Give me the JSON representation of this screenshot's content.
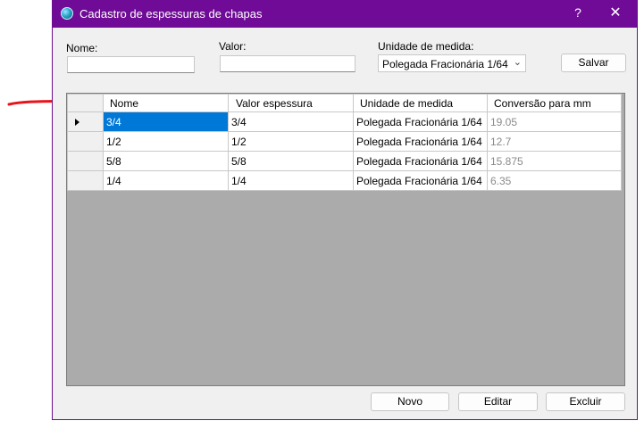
{
  "window": {
    "title": "Cadastro de espessuras de chapas"
  },
  "titlebar": {
    "help": "?",
    "close": "✕"
  },
  "form": {
    "nome_label": "Nome:",
    "nome_value": "",
    "valor_label": "Valor:",
    "valor_value": "",
    "unidade_label": "Unidade de medida:",
    "unidade_selected": "Polegada Fracionária 1/64",
    "salvar": "Salvar"
  },
  "grid": {
    "columns": [
      "Nome",
      "Valor espessura",
      "Unidade de medida",
      "Conversão para mm"
    ],
    "rows": [
      [
        "3/4",
        "3/4",
        "Polegada Fracionária 1/64",
        "19.05"
      ],
      [
        "1/2",
        "1/2",
        "Polegada Fracionária 1/64",
        "12.7"
      ],
      [
        "5/8",
        "5/8",
        "Polegada Fracionária 1/64",
        "15.875"
      ],
      [
        "1/4",
        "1/4",
        "Polegada Fracionária 1/64",
        "6.35"
      ]
    ],
    "selected_row": 0
  },
  "footer": {
    "novo": "Novo",
    "editar": "Editar",
    "excluir": "Excluir"
  },
  "colors": {
    "titlebar": "#6f0b96",
    "selection": "#0078d7",
    "annotation_arrow": "#e8141b"
  },
  "icons": {
    "app": "globe-icon",
    "row_pointer": "row-pointer-icon",
    "arrow": "red-arrow-icon",
    "dropdown": "chevron-down-icon"
  }
}
